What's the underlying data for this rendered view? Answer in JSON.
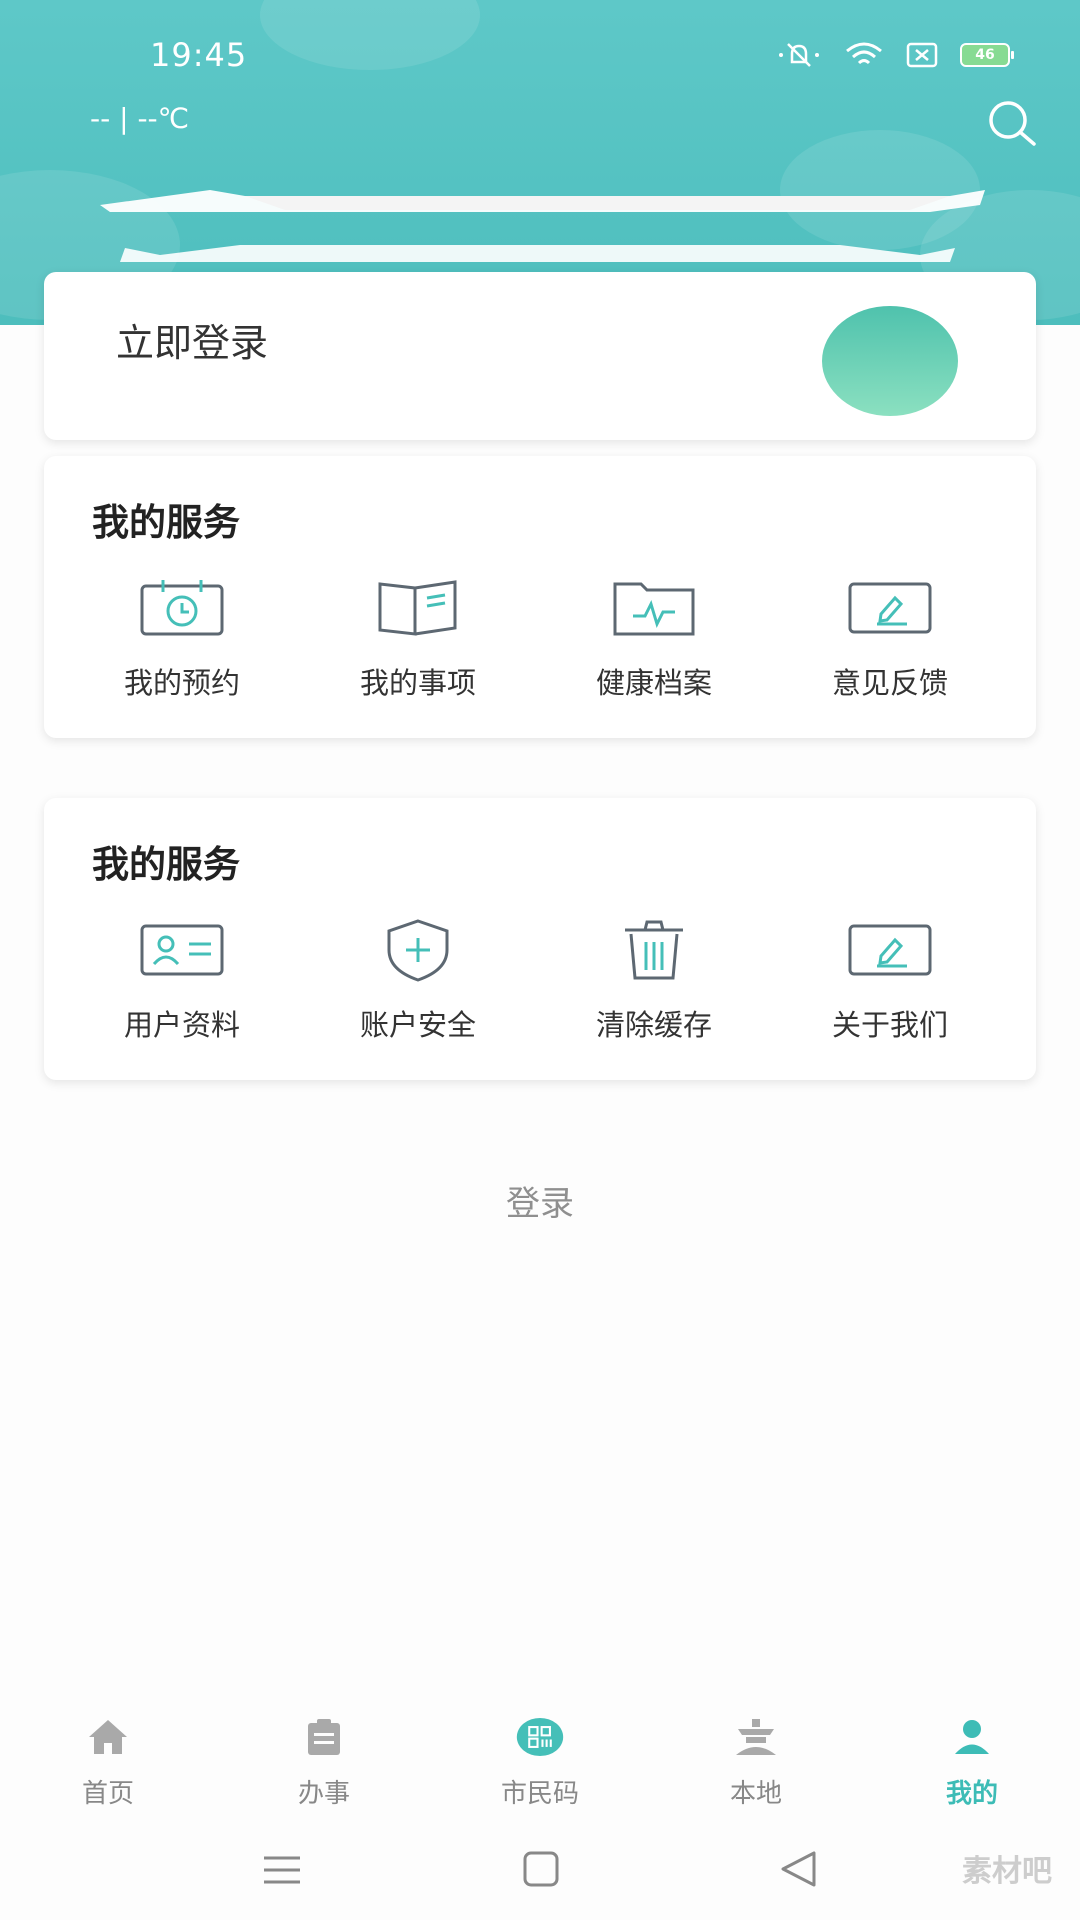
{
  "status_bar": {
    "time": "19:45",
    "battery": "46"
  },
  "header": {
    "weather": "-- | --℃"
  },
  "login_card": {
    "label": "立即登录"
  },
  "services": [
    {
      "title": "我的服务",
      "items": [
        {
          "label": "我的预约",
          "icon": "calendar-clock-icon"
        },
        {
          "label": "我的事项",
          "icon": "book-icon"
        },
        {
          "label": "健康档案",
          "icon": "health-folder-icon"
        },
        {
          "label": "意见反馈",
          "icon": "feedback-pen-icon"
        }
      ]
    },
    {
      "title": "我的服务",
      "items": [
        {
          "label": "用户资料",
          "icon": "id-card-icon"
        },
        {
          "label": "账户安全",
          "icon": "shield-plus-icon"
        },
        {
          "label": "清除缓存",
          "icon": "trash-icon"
        },
        {
          "label": "关于我们",
          "icon": "about-pen-icon"
        }
      ]
    }
  ],
  "login_link": "登录",
  "tabbar": [
    {
      "label": "首页",
      "icon": "home-icon",
      "active": false
    },
    {
      "label": "办事",
      "icon": "clipboard-icon",
      "active": false
    },
    {
      "label": "市民码",
      "icon": "qr-code-icon",
      "active": false
    },
    {
      "label": "本地",
      "icon": "landmark-icon",
      "active": false
    },
    {
      "label": "我的",
      "icon": "user-icon",
      "active": true
    }
  ],
  "watermark": "素材吧",
  "colors": {
    "header": "#4dbebd",
    "accent": "#3dbcb6",
    "icon_teal": "#45bfb8",
    "icon_gray": "#5d6872"
  }
}
